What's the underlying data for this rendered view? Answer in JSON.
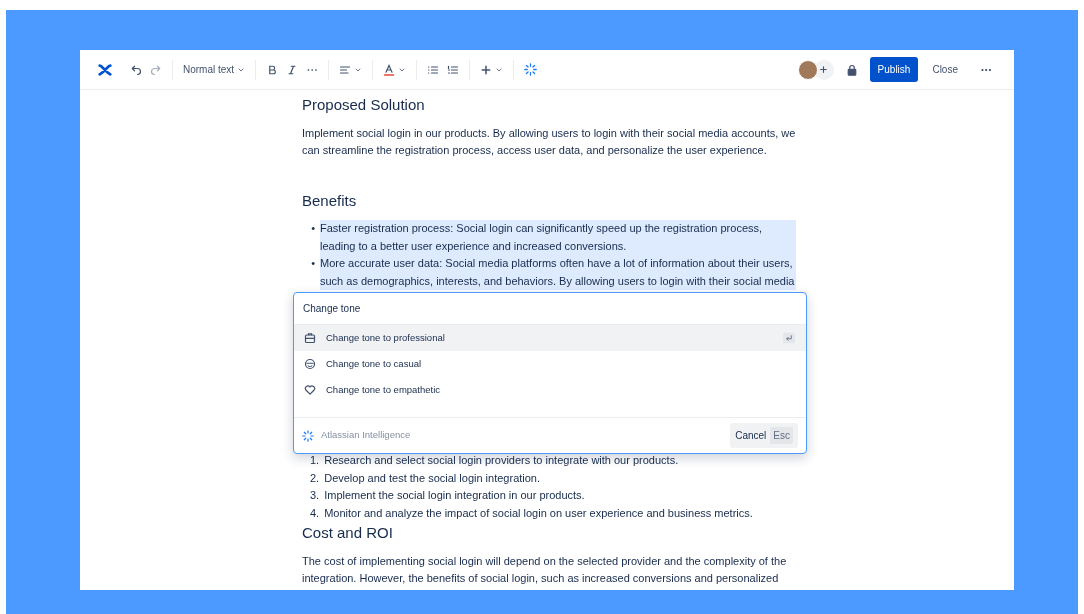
{
  "toolbar": {
    "text_style": "Normal text",
    "publish": "Publish",
    "close": "Close"
  },
  "document": [
    {
      "kind": "heading",
      "text": "Proposed Solution"
    },
    {
      "kind": "paragraph",
      "text": "Implement social login in our products. By allowing users to login with their social media accounts, we can streamline the registration process, access user data, and personalize the user experience."
    },
    {
      "kind": "heading",
      "text": "Benefits"
    },
    {
      "kind": "bullets",
      "selected": true,
      "items": [
        {
          "marker": "•",
          "text": "Faster registration process: Social login can significantly speed up the registration process, leading to a better user experience and increased conversions."
        },
        {
          "marker": "•",
          "text": "More accurate user data: Social media platforms often have a lot of information about their users, such as demographics, interests, and behaviors. By allowing users to login with their social media"
        }
      ]
    },
    {
      "kind": "gap"
    },
    {
      "kind": "numbers",
      "items": [
        {
          "marker": "1.",
          "text": "Research and select social login providers to integrate with our products."
        },
        {
          "marker": "2.",
          "text": "Develop and test the social login integration."
        },
        {
          "marker": "3.",
          "text": "Implement the social login integration in our products."
        },
        {
          "marker": "4.",
          "text": "Monitor and analyze the impact of social login on user experience and business metrics."
        }
      ]
    },
    {
      "kind": "heading",
      "text": "Cost and ROI"
    },
    {
      "kind": "paragraph",
      "text": "The cost of implementing social login will depend on the selected provider and the complexity of the integration. However, the benefits of social login, such as increased conversions and personalized"
    }
  ],
  "ai_dialog": {
    "query": "Change tone",
    "options": [
      {
        "label": "Change tone to professional",
        "selected": true
      },
      {
        "label": "Change tone to casual",
        "selected": false
      },
      {
        "label": "Change tone to empathetic",
        "selected": false
      }
    ],
    "brand": "Atlassian Intelligence",
    "cancel": "Cancel",
    "cancel_key": "Esc"
  }
}
